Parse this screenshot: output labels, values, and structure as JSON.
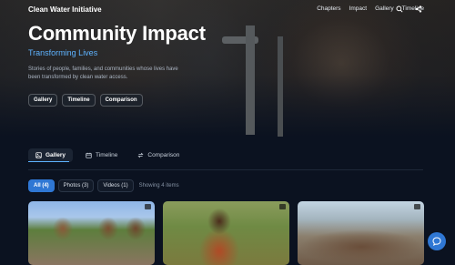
{
  "nav": {
    "brand": "Clean Water Initiative",
    "links": [
      "Chapters",
      "Impact",
      "Gallery",
      "Timeline"
    ],
    "icons": [
      "search-icon",
      "share-icon"
    ]
  },
  "hero": {
    "title": "Community Impact",
    "subtitle": "Transforming Lives",
    "description": "Stories of people, families, and communities whose lives have been transformed by clean water access.",
    "buttons": [
      "Gallery",
      "Timeline",
      "Comparison"
    ]
  },
  "tabs": [
    {
      "label": "Gallery",
      "icon": "image-icon",
      "active": true
    },
    {
      "label": "Timeline",
      "icon": "calendar-icon",
      "active": false
    },
    {
      "label": "Comparison",
      "icon": "swap-icon",
      "active": false
    }
  ],
  "filters": {
    "buttons": [
      {
        "label": "All (4)",
        "active": true
      },
      {
        "label": "Photos (3)",
        "active": false
      },
      {
        "label": "Videos (1)",
        "active": false
      }
    ],
    "count_text": "Showing 4 items"
  },
  "gallery": {
    "items": [
      {
        "icon": "photo-type-icon"
      },
      {
        "icon": "photo-type-icon"
      },
      {
        "icon": "photo-type-icon"
      }
    ]
  },
  "colors": {
    "accent": "#2f77d4",
    "subtitle": "#5eb3ff",
    "background": "#0b1220"
  }
}
